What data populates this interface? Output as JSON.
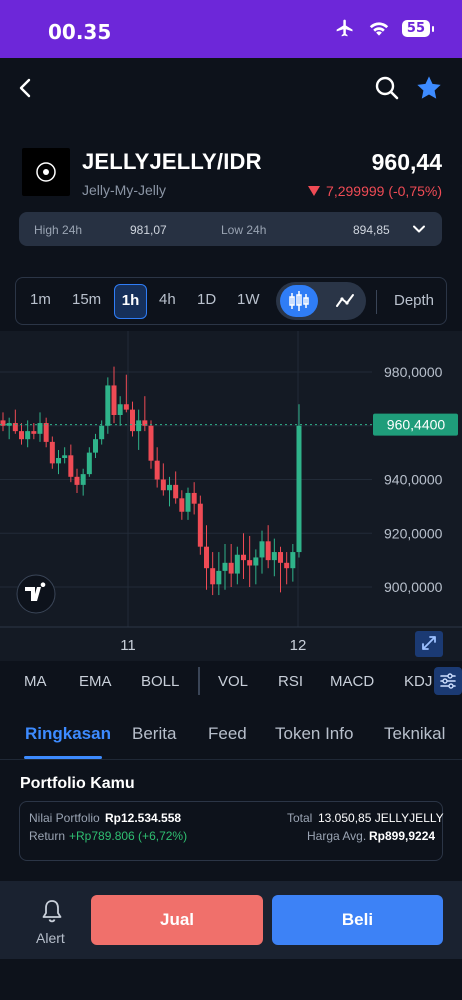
{
  "status_bar": {
    "time": "00.35",
    "battery": "55",
    "icons": [
      "airplane-icon",
      "wifi-icon",
      "battery-icon"
    ]
  },
  "header": {
    "icons": [
      "back-icon",
      "search-icon",
      "star-icon"
    ]
  },
  "pair": {
    "name": "JELLYJELLY/IDR",
    "subtitle": "Jelly-My-Jelly",
    "price": "960,44",
    "change": "7,299999 (-0,75%)"
  },
  "high_low": {
    "high_label": "High 24h",
    "high_value": "981,07",
    "low_label": "Low 24h",
    "low_value": "894,85"
  },
  "timeframes": {
    "m1": "1m",
    "m15": "15m",
    "h1": "1h",
    "h4": "4h",
    "d1": "1D",
    "w1": "1W",
    "depth": "Depth",
    "active": "1h"
  },
  "chart_data": {
    "type": "candlestick",
    "y_ticks": [
      "980,0000",
      "960,0000",
      "940,0000",
      "920,0000",
      "900,0000"
    ],
    "x_ticks": [
      "11",
      "12"
    ],
    "current_price_label": "960,4400",
    "ylim": [
      890,
      990
    ],
    "last_price": 960.44,
    "candles": [
      [
        962,
        965,
        958,
        960
      ],
      [
        960,
        963,
        955,
        961
      ],
      [
        961,
        966,
        957,
        958
      ],
      [
        958,
        961,
        953,
        955
      ],
      [
        955,
        962,
        952,
        958
      ],
      [
        958,
        961,
        955,
        957
      ],
      [
        957,
        965,
        954,
        961
      ],
      [
        961,
        963,
        952,
        954
      ],
      [
        954,
        956,
        944,
        946
      ],
      [
        946,
        951,
        942,
        948
      ],
      [
        948,
        952,
        946,
        949
      ],
      [
        949,
        953,
        939,
        941
      ],
      [
        941,
        944,
        935,
        938
      ],
      [
        938,
        944,
        934,
        942
      ],
      [
        942,
        952,
        941,
        950
      ],
      [
        950,
        957,
        948,
        955
      ],
      [
        955,
        962,
        953,
        960
      ],
      [
        960,
        978,
        957,
        975
      ],
      [
        975,
        982,
        961,
        964
      ],
      [
        964,
        971,
        960,
        968
      ],
      [
        968,
        979,
        965,
        966
      ],
      [
        966,
        969,
        956,
        958
      ],
      [
        958,
        966,
        951,
        962
      ],
      [
        962,
        971,
        958,
        960
      ],
      [
        960,
        962,
        944,
        947
      ],
      [
        947,
        952,
        937,
        940
      ],
      [
        940,
        946,
        934,
        936
      ],
      [
        936,
        941,
        930,
        938
      ],
      [
        938,
        943,
        931,
        933
      ],
      [
        933,
        936,
        925,
        928
      ],
      [
        928,
        937,
        925,
        935
      ],
      [
        935,
        939,
        927,
        931
      ],
      [
        931,
        934,
        912,
        915
      ],
      [
        915,
        923,
        899,
        907
      ],
      [
        907,
        913,
        897,
        901
      ],
      [
        901,
        913,
        897,
        906
      ],
      [
        906,
        916,
        899,
        909
      ],
      [
        909,
        916,
        900,
        905
      ],
      [
        905,
        915,
        901,
        912
      ],
      [
        912,
        920,
        903,
        910
      ],
      [
        910,
        919,
        900,
        908
      ],
      [
        908,
        914,
        901,
        911
      ],
      [
        911,
        921,
        905,
        917
      ],
      [
        917,
        923,
        907,
        910
      ],
      [
        910,
        918,
        904,
        913
      ],
      [
        913,
        915,
        898,
        909
      ],
      [
        909,
        913,
        901,
        907
      ],
      [
        907,
        916,
        902,
        913
      ],
      [
        913,
        968,
        911,
        960
      ]
    ]
  },
  "indicators": [
    "MA",
    "EMA",
    "BOLL",
    "VOL",
    "RSI",
    "MACD",
    "KDJ"
  ],
  "tabs": [
    "Ringkasan",
    "Berita",
    "Feed",
    "Token Info",
    "Teknikal"
  ],
  "portfolio": {
    "title": "Portfolio Kamu",
    "nilai_label": "Nilai Portfolio",
    "nilai_value": "Rp12.534.558",
    "return_label": "Return",
    "return_value": "+Rp789.806 (+6,72%)",
    "total_label": "Total",
    "total_value": "13.050,85 JELLYJELLY",
    "avg_label": "Harga Avg.",
    "avg_value": "Rp899,9224"
  },
  "actions": {
    "alert": "Alert",
    "sell": "Jual",
    "buy": "Beli"
  },
  "colors": {
    "up": "#2fb38a",
    "down": "#ef4b55",
    "accent": "#3d8bff",
    "status_bar": "#6d27d9"
  }
}
